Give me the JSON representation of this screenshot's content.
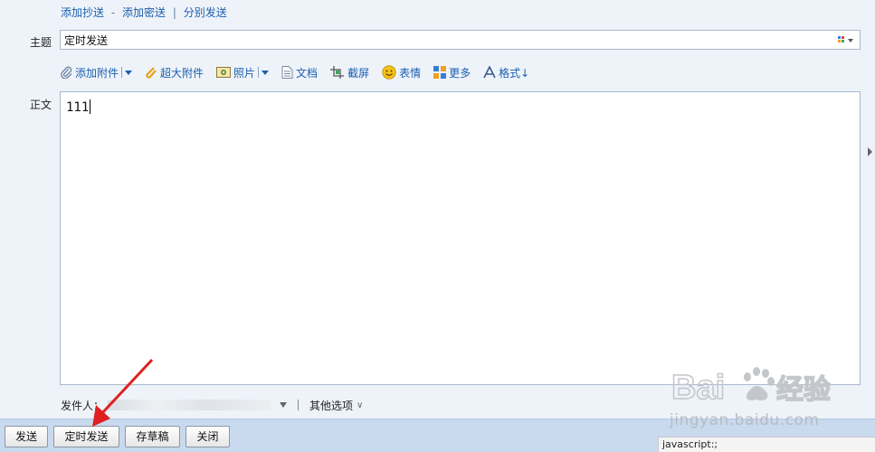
{
  "cc_links": {
    "add_cc": "添加抄送",
    "separator_dash": "-",
    "add_bcc": "添加密送",
    "separator_bar": "|",
    "separate_send": "分别发送"
  },
  "subject": {
    "label": "主题",
    "value": "定时发送",
    "icon": "grid-icon"
  },
  "toolbar": {
    "add_attachment": "添加附件",
    "large_attachment": "超大附件",
    "photo": "照片",
    "document": "文档",
    "screenshot": "截屏",
    "emoji": "表情",
    "more": "更多",
    "format": "格式↓"
  },
  "body": {
    "label": "正文",
    "text": "111"
  },
  "sender": {
    "label": "发件人：",
    "more_options": "其他选项"
  },
  "buttons": {
    "send": "发送",
    "scheduled_send": "定时发送",
    "save_draft": "存草稿",
    "close": "关闭"
  },
  "status_bar": {
    "text": "javascript:;"
  },
  "watermark": {
    "brand": "Baidu 经验",
    "url": "jingyan.baidu.com"
  },
  "colors": {
    "link": "#1b5fae",
    "page_bg": "#eef3fa",
    "bottom_bar": "#c9d9ee",
    "annotation_arrow": "#e02020"
  }
}
